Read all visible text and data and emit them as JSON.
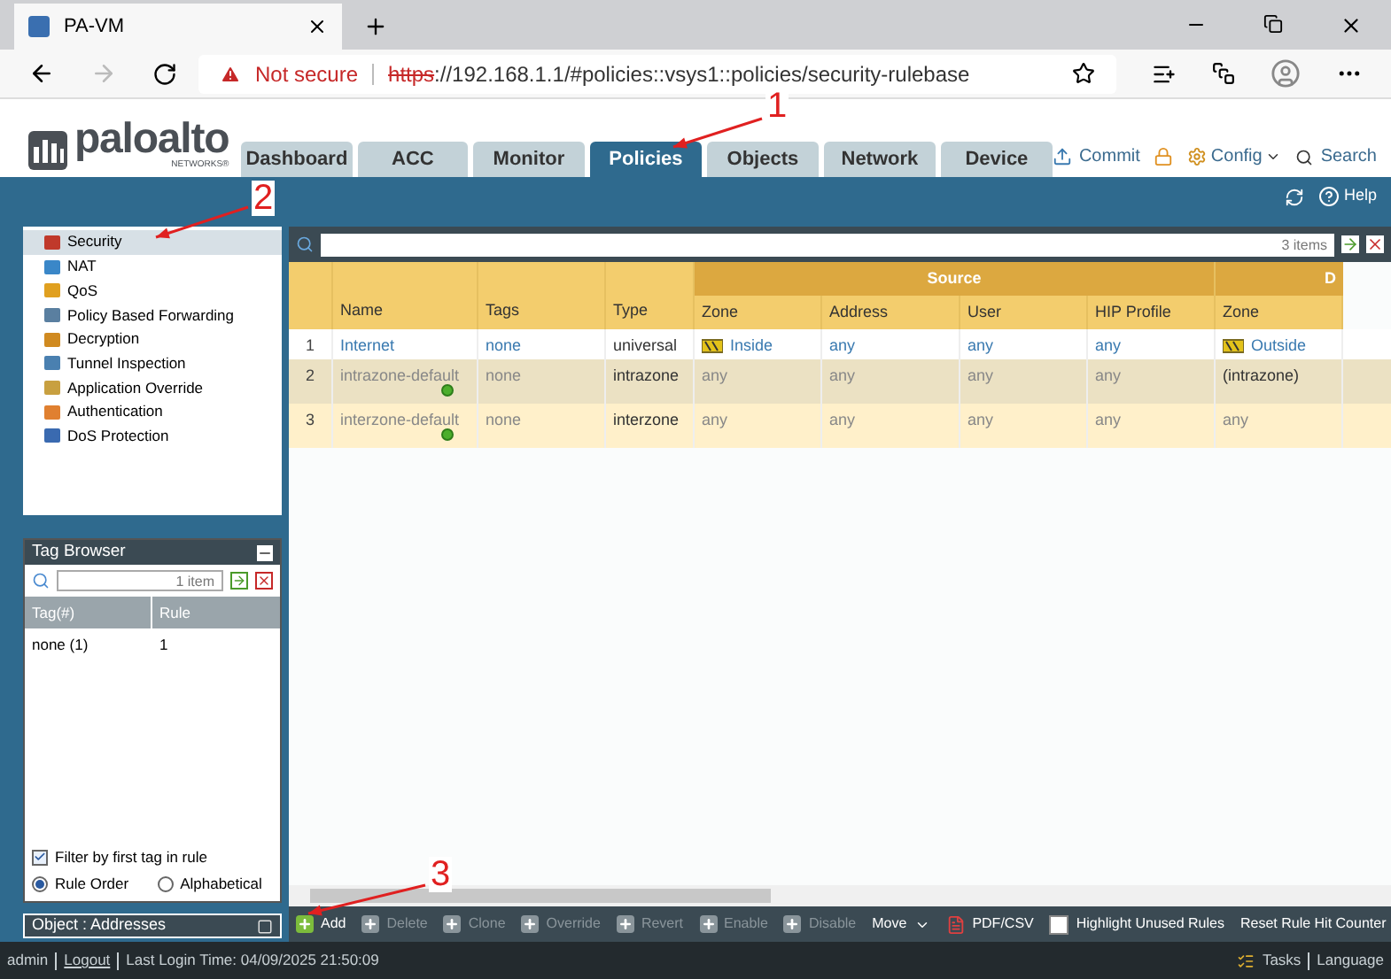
{
  "browser": {
    "tab_title": "PA-VM",
    "security_label": "Not secure",
    "url_scheme": "https",
    "url_rest": "://192.168.1.1/#policies::vsys1::policies/security-rulebase"
  },
  "logo": {
    "name": "paloalto",
    "subtitle": "NETWORKS®"
  },
  "tabs": [
    {
      "label": "Dashboard",
      "selected": false
    },
    {
      "label": "ACC",
      "selected": false
    },
    {
      "label": "Monitor",
      "selected": false
    },
    {
      "label": "Policies",
      "selected": true
    },
    {
      "label": "Objects",
      "selected": false
    },
    {
      "label": "Network",
      "selected": false
    },
    {
      "label": "Device",
      "selected": false
    }
  ],
  "header_actions": {
    "commit": "Commit",
    "config": "Config",
    "search": "Search",
    "help": "Help"
  },
  "sidebar": {
    "items": [
      {
        "label": "Security",
        "selected": true,
        "color": "#c0392b"
      },
      {
        "label": "NAT",
        "selected": false,
        "color": "#3a87c8"
      },
      {
        "label": "QoS",
        "selected": false,
        "color": "#e0a020"
      },
      {
        "label": "Policy Based Forwarding",
        "selected": false,
        "color": "#5a7fa0"
      },
      {
        "label": "Decryption",
        "selected": false,
        "color": "#d08a20"
      },
      {
        "label": "Tunnel Inspection",
        "selected": false,
        "color": "#4a80b0"
      },
      {
        "label": "Application Override",
        "selected": false,
        "color": "#c8a040"
      },
      {
        "label": "Authentication",
        "selected": false,
        "color": "#e08030"
      },
      {
        "label": "DoS Protection",
        "selected": false,
        "color": "#3a6ab0"
      }
    ]
  },
  "tag_browser": {
    "title": "Tag Browser",
    "count": "1 item",
    "columns": [
      "Tag(#)",
      "Rule"
    ],
    "rows": [
      [
        "none (1)",
        "1"
      ]
    ],
    "filter_checkbox": {
      "label": "Filter by first tag in rule",
      "checked": true
    },
    "sort_options": [
      {
        "label": "Rule Order",
        "selected": true
      },
      {
        "label": "Alphabetical",
        "selected": false
      }
    ]
  },
  "object_panel": {
    "title": "Object : Addresses"
  },
  "rules": {
    "count": "3 items",
    "group_header": "Source",
    "group_header_cut": "D",
    "columns": [
      "Name",
      "Tags",
      "Type",
      "Zone",
      "Address",
      "User",
      "HIP Profile",
      "Zone"
    ],
    "rows": [
      {
        "index": "1",
        "kind": "custom",
        "cells": [
          "Internet",
          "none",
          "universal",
          "Inside",
          "any",
          "any",
          "any",
          "Outside"
        ]
      },
      {
        "index": "2",
        "kind": "default",
        "cells": [
          "intrazone-default",
          "none",
          "intrazone",
          "any",
          "any",
          "any",
          "any",
          "(intrazone)"
        ]
      },
      {
        "index": "3",
        "kind": "default",
        "cells": [
          "interzone-default",
          "none",
          "interzone",
          "any",
          "any",
          "any",
          "any",
          "any"
        ]
      }
    ]
  },
  "toolbar": [
    {
      "kind": "action",
      "label": "Add",
      "disabled": false
    },
    {
      "kind": "action",
      "label": "Delete",
      "disabled": true
    },
    {
      "kind": "action",
      "label": "Clone",
      "disabled": true
    },
    {
      "kind": "action",
      "label": "Override",
      "disabled": true
    },
    {
      "kind": "action",
      "label": "Revert",
      "disabled": true
    },
    {
      "kind": "action",
      "label": "Enable",
      "disabled": true
    },
    {
      "kind": "action",
      "label": "Disable",
      "disabled": true
    },
    {
      "kind": "menu",
      "label": "Move",
      "disabled": false
    },
    {
      "kind": "export",
      "label": "PDF/CSV",
      "disabled": false
    },
    {
      "kind": "checkbox",
      "label": "Highlight Unused Rules",
      "checked": false
    },
    {
      "kind": "menu",
      "label": "Reset Rule Hit Counter",
      "disabled": false
    }
  ],
  "status_bar": {
    "user": "admin",
    "logout": "Logout",
    "last_login": "Last Login Time: 04/09/2025 21:50:09",
    "tasks": "Tasks",
    "language": "Language"
  },
  "annotations": [
    {
      "label": "1"
    },
    {
      "label": "2"
    },
    {
      "label": "3"
    }
  ]
}
